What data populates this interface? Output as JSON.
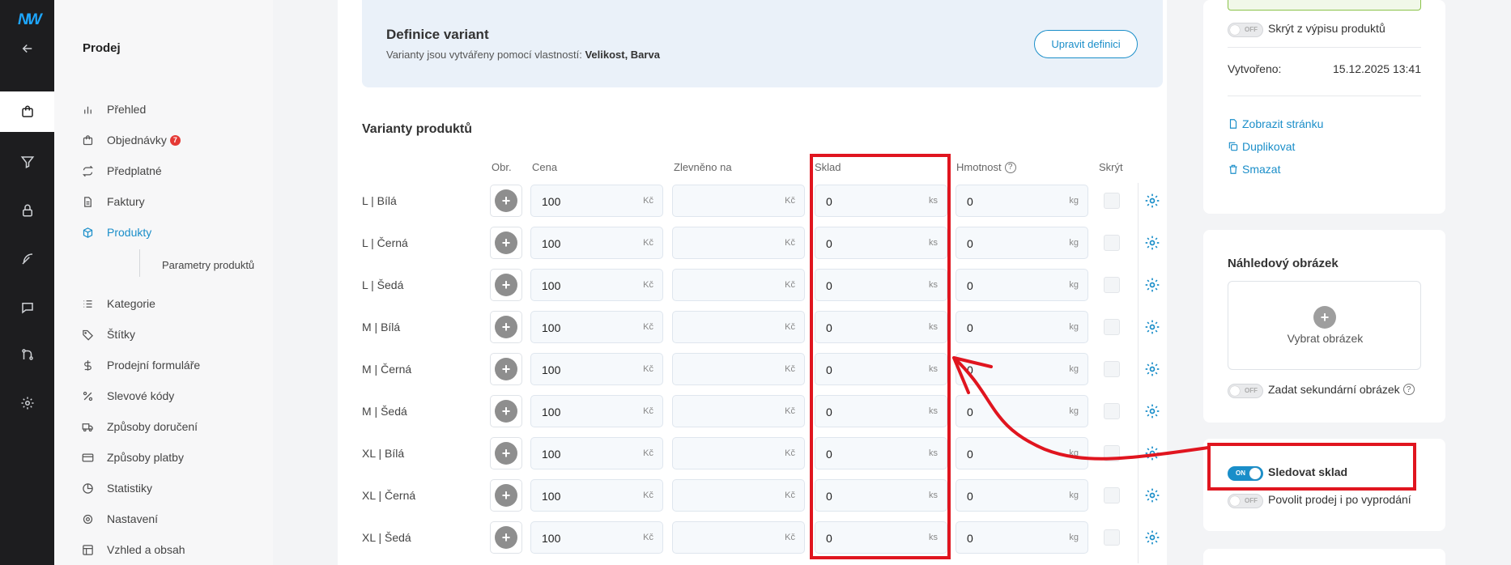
{
  "app": {
    "logo": "NW"
  },
  "rail": {
    "icons": [
      "back-arrow-icon",
      "shopping-bag-icon",
      "funnel-icon",
      "lock-icon",
      "feather-icon",
      "chat-icon",
      "git-merge-icon",
      "gear-icon"
    ]
  },
  "sidebar": {
    "section_title": "Prodej",
    "items": [
      {
        "label": "Přehled",
        "icon": "bar-chart-icon"
      },
      {
        "label": "Objednávky",
        "icon": "bag-icon",
        "badge": "7"
      },
      {
        "label": "Předplatné",
        "icon": "repeat-icon"
      },
      {
        "label": "Faktury",
        "icon": "document-icon"
      },
      {
        "label": "Produkty",
        "icon": "box-icon",
        "active": true
      },
      {
        "label": "Kategorie",
        "icon": "list-icon"
      },
      {
        "label": "Štítky",
        "icon": "tag-icon"
      },
      {
        "label": "Prodejní formuláře",
        "icon": "dollar-icon"
      },
      {
        "label": "Slevové kódy",
        "icon": "percent-icon"
      },
      {
        "label": "Způsoby doručení",
        "icon": "truck-icon"
      },
      {
        "label": "Způsoby platby",
        "icon": "credit-card-icon"
      },
      {
        "label": "Statistiky",
        "icon": "pie-chart-icon"
      },
      {
        "label": "Nastavení",
        "icon": "cog-icon"
      },
      {
        "label": "Vzhled a obsah",
        "icon": "layout-icon"
      }
    ],
    "sub_item": "Parametry produktů"
  },
  "definition": {
    "title": "Definice variant",
    "text_prefix": "Varianty jsou vytvářeny pomocí vlastností:",
    "text_props": "Velikost, Barva",
    "button": "Upravit definici"
  },
  "variants": {
    "title": "Varianty produktů",
    "columns": {
      "image": "Obr.",
      "price": "Cena",
      "discount": "Zlevněno na",
      "stock": "Sklad",
      "weight": "Hmotnost",
      "hide": "Skrýt",
      "weight_help": "?"
    },
    "units": {
      "price": "Kč",
      "stock": "ks",
      "weight": "kg"
    },
    "plus_symbol": "+",
    "rows": [
      {
        "label": "L  |  Bílá",
        "price": "100",
        "discount": "",
        "stock": "0",
        "weight": "0"
      },
      {
        "label": "L  |  Černá",
        "price": "100",
        "discount": "",
        "stock": "0",
        "weight": "0"
      },
      {
        "label": "L  |  Šedá",
        "price": "100",
        "discount": "",
        "stock": "0",
        "weight": "0"
      },
      {
        "label": "M  |  Bílá",
        "price": "100",
        "discount": "",
        "stock": "0",
        "weight": "0"
      },
      {
        "label": "M  |  Černá",
        "price": "100",
        "discount": "",
        "stock": "0",
        "weight": "0"
      },
      {
        "label": "M  |  Šedá",
        "price": "100",
        "discount": "",
        "stock": "0",
        "weight": "0"
      },
      {
        "label": "XL  |  Bílá",
        "price": "100",
        "discount": "",
        "stock": "0",
        "weight": "0"
      },
      {
        "label": "XL  |  Černá",
        "price": "100",
        "discount": "",
        "stock": "0",
        "weight": "0"
      },
      {
        "label": "XL  |  Šedá",
        "price": "100",
        "discount": "",
        "stock": "0",
        "weight": "0"
      }
    ]
  },
  "right_panel": {
    "hide_from_listing": "Skrýt z výpisu produktů",
    "created_label": "Vytvořeno:",
    "created_value": "15.12.2025 13:41",
    "links": {
      "view": "Zobrazit stránku",
      "duplicate": "Duplikovat",
      "delete": "Smazat"
    },
    "preview_title": "Náhledový obrázek",
    "choose_image": "Vybrat obrázek",
    "secondary_image": "Zadat sekundární obrázek",
    "track_stock": "Sledovat sklad",
    "allow_after_sold": "Povolit prodej i po vyprodání",
    "toggle_on": "ON",
    "toggle_off": "OFF"
  },
  "colors": {
    "accent": "#1a8ec9",
    "highlight": "#e0151f",
    "rail": "#1d1d1f"
  }
}
